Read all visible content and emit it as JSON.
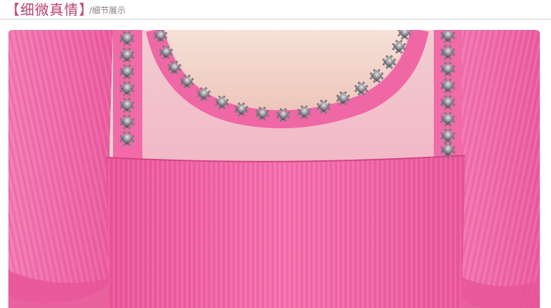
{
  "header": {
    "title_open_bracket": "【",
    "title": "细微真情",
    "title_close_bracket": "】",
    "subtitle": "/细节展示"
  },
  "photo": {
    "subject": "blouse-neckline-detail",
    "colors": {
      "fabric": "#f067a6",
      "fabric_shadow": "#d9488a",
      "mesh": "#f2c4cf",
      "skin": "#f3d7cd",
      "bead": "#8f8f93",
      "accent": "#b8416e"
    }
  }
}
